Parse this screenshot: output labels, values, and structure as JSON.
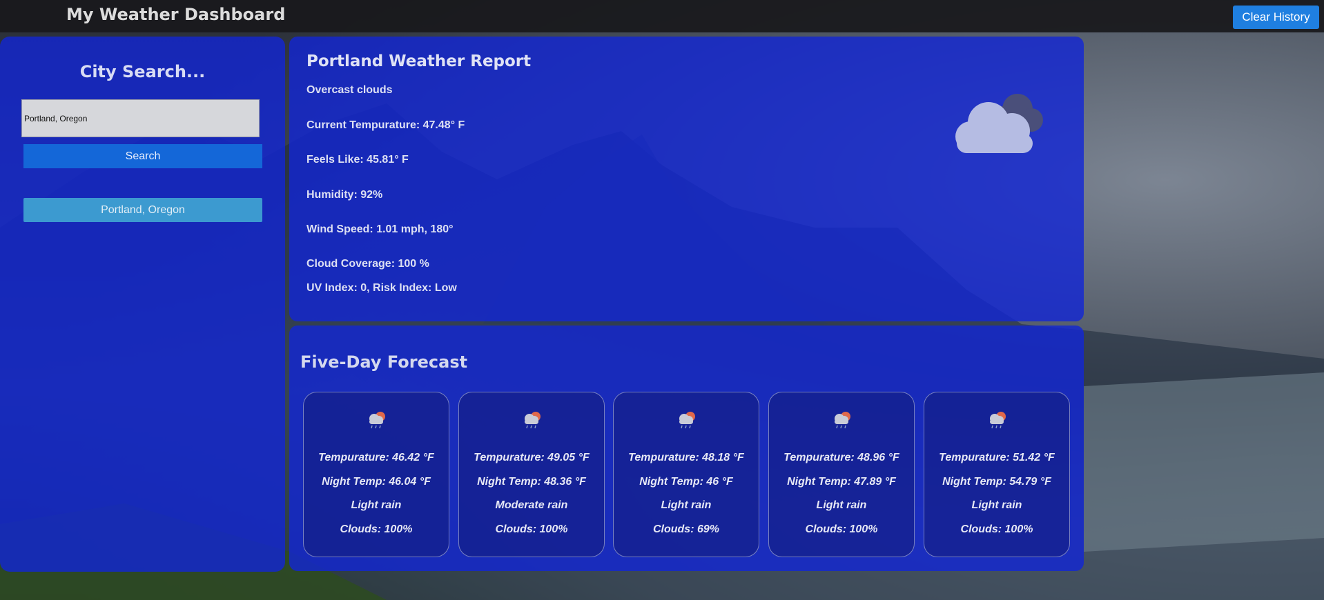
{
  "header": {
    "title": "My Weather Dashboard",
    "clear_history_label": "Clear History"
  },
  "sidebar": {
    "title": "City Search...",
    "search_value": "Portland, Oregon",
    "search_button_label": "Search",
    "history": [
      "Portland, Oregon"
    ]
  },
  "current": {
    "title": "Portland Weather Report",
    "description": "Overcast clouds",
    "temperature": "Current Tempurature: 47.48° F",
    "feels_like": "Feels Like: 45.81° F",
    "humidity": "Humidity: 92%",
    "wind": "Wind Speed: 1.01 mph, 180°",
    "clouds": "Cloud Coverage: 100 %",
    "uv": "UV Index: 0, Risk Index: Low",
    "icon": "overcast-clouds-icon"
  },
  "forecast": {
    "title": "Five-Day Forecast",
    "days": [
      {
        "icon": "light-rain-icon",
        "temp": "Tempurature: 46.42 °F",
        "night": "Night Temp: 46.04 °F",
        "desc": "Light rain",
        "clouds": "Clouds: 100%"
      },
      {
        "icon": "light-rain-icon",
        "temp": "Tempurature: 49.05 °F",
        "night": "Night Temp: 48.36 °F",
        "desc": "Moderate rain",
        "clouds": "Clouds: 100%"
      },
      {
        "icon": "light-rain-icon",
        "temp": "Tempurature: 48.18 °F",
        "night": "Night Temp: 46 °F",
        "desc": "Light rain",
        "clouds": "Clouds: 69%"
      },
      {
        "icon": "light-rain-icon",
        "temp": "Tempurature: 48.96 °F",
        "night": "Night Temp: 47.89 °F",
        "desc": "Light rain",
        "clouds": "Clouds: 100%"
      },
      {
        "icon": "light-rain-icon",
        "temp": "Tempurature: 51.42 °F",
        "night": "Night Temp: 54.79 °F",
        "desc": "Light rain",
        "clouds": "Clouds: 100%"
      }
    ]
  },
  "colors": {
    "panel": "#1226d6",
    "clear_button": "#1f7fe0",
    "search_button": "#1467d8",
    "history_button": "#3c9ad0",
    "topbar": "#19191c"
  }
}
